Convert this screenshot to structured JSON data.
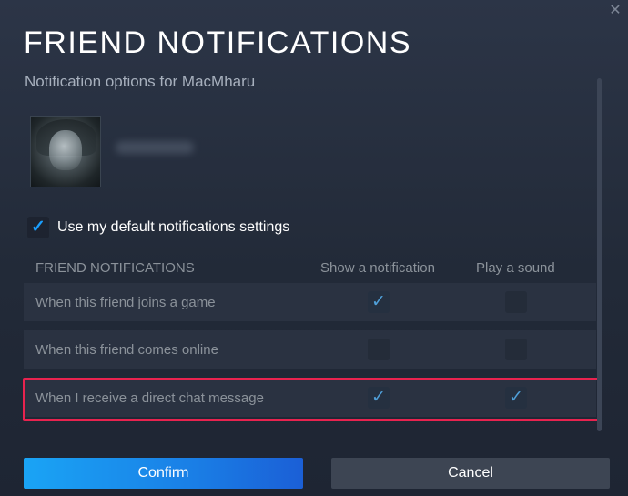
{
  "dialog": {
    "title": "FRIEND NOTIFICATIONS",
    "subtitle": "Notification options for MacMharu",
    "close_icon": "close-icon"
  },
  "friend": {
    "avatar_icon": "avatar-image",
    "name_blurred": true
  },
  "default_settings": {
    "label": "Use my default notifications settings",
    "checked": true
  },
  "table": {
    "headers": {
      "section": "FRIEND NOTIFICATIONS",
      "show": "Show a notification",
      "sound": "Play a sound"
    },
    "rows": [
      {
        "label": "When this friend joins a game",
        "show": true,
        "sound": false
      },
      {
        "label": "When this friend comes online",
        "show": false,
        "sound": false
      },
      {
        "label": "When I receive a direct chat message",
        "show": true,
        "sound": true,
        "highlighted": true
      }
    ]
  },
  "buttons": {
    "confirm": "Confirm",
    "cancel": "Cancel"
  },
  "colors": {
    "accent": "#1a9fff",
    "highlight": "#e8234f",
    "confirm_gradient_start": "#1aa4f5",
    "confirm_gradient_end": "#1b5fd6",
    "cancel_bg": "#3d4553"
  }
}
